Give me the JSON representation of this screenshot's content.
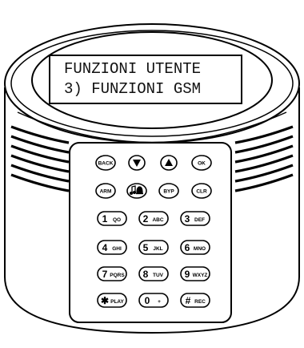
{
  "display": {
    "line1": "FUNZIONI UTENTE",
    "line2": "3) FUNZIONI GSM"
  },
  "keypad": {
    "rows": [
      [
        {
          "id": "back",
          "label": "BACK"
        },
        {
          "id": "down",
          "icon": "arrow-down-icon"
        },
        {
          "id": "up",
          "icon": "arrow-up-icon"
        },
        {
          "id": "ok",
          "label": "OK"
        }
      ],
      [
        {
          "id": "arm",
          "label": "ARM"
        },
        {
          "id": "chime",
          "icon": "chime-bell-icon"
        },
        {
          "id": "byp",
          "label": "BYP"
        },
        {
          "id": "clr",
          "label": "CLR"
        }
      ],
      [
        {
          "id": "1",
          "main": "1",
          "sub": "QO"
        },
        {
          "id": "2",
          "main": "2",
          "sub": "ABC"
        },
        {
          "id": "3",
          "main": "3",
          "sub": "DEF"
        }
      ],
      [
        {
          "id": "4",
          "main": "4",
          "sub": "GHI"
        },
        {
          "id": "5",
          "main": "5",
          "sub": "JKL"
        },
        {
          "id": "6",
          "main": "6",
          "sub": "MNO"
        }
      ],
      [
        {
          "id": "7",
          "main": "7",
          "sub": "PQRS"
        },
        {
          "id": "8",
          "main": "8",
          "sub": "TUV"
        },
        {
          "id": "9",
          "main": "9",
          "sub": "WXYZ"
        }
      ],
      [
        {
          "id": "star",
          "main": "✱",
          "sub": "PLAY"
        },
        {
          "id": "0",
          "main": "0",
          "sub": "+"
        },
        {
          "id": "hash",
          "main": "#",
          "sub": "REC"
        }
      ]
    ]
  }
}
